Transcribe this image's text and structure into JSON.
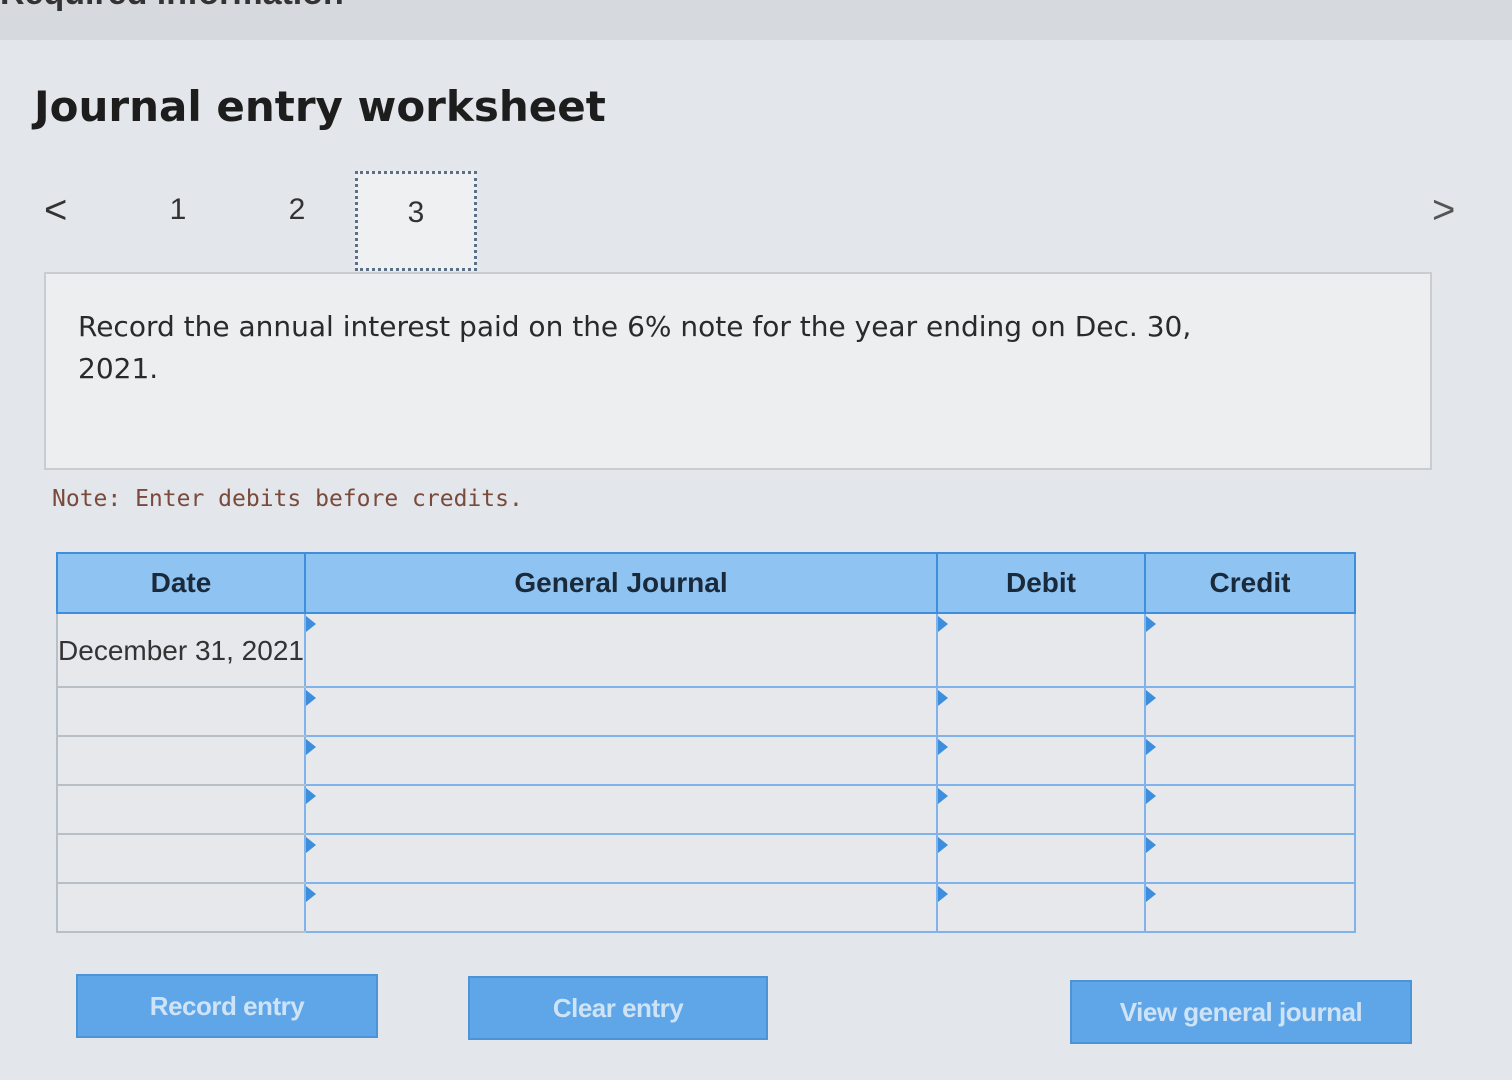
{
  "header": {
    "cut_title": "Required information",
    "title": "Journal entry worksheet"
  },
  "pager": {
    "prev_icon": "chevron-left-icon",
    "next_icon": "chevron-right-icon",
    "prev_glyph": "<",
    "next_glyph": ">",
    "pages": [
      "1",
      "2",
      "3"
    ],
    "current": "3"
  },
  "question": {
    "text": "Record the annual interest paid on the 6% note for the year ending on Dec. 30, 2021."
  },
  "note": "Note: Enter debits before credits.",
  "journal": {
    "headers": {
      "date": "Date",
      "general_journal": "General Journal",
      "debit": "Debit",
      "credit": "Credit"
    },
    "rows": [
      {
        "date": "December 31, 2021",
        "account": "",
        "debit": "",
        "credit": ""
      },
      {
        "date": "",
        "account": "",
        "debit": "",
        "credit": ""
      },
      {
        "date": "",
        "account": "",
        "debit": "",
        "credit": ""
      },
      {
        "date": "",
        "account": "",
        "debit": "",
        "credit": ""
      },
      {
        "date": "",
        "account": "",
        "debit": "",
        "credit": ""
      },
      {
        "date": "",
        "account": "",
        "debit": "",
        "credit": ""
      }
    ]
  },
  "buttons": {
    "record": "Record entry",
    "clear": "Clear entry",
    "view": "View general journal"
  },
  "colors": {
    "header_blue": "#8fc3f2",
    "border_blue": "#3d8edc",
    "button_blue": "#5ea6e8",
    "note_color": "#7a4a3c"
  }
}
